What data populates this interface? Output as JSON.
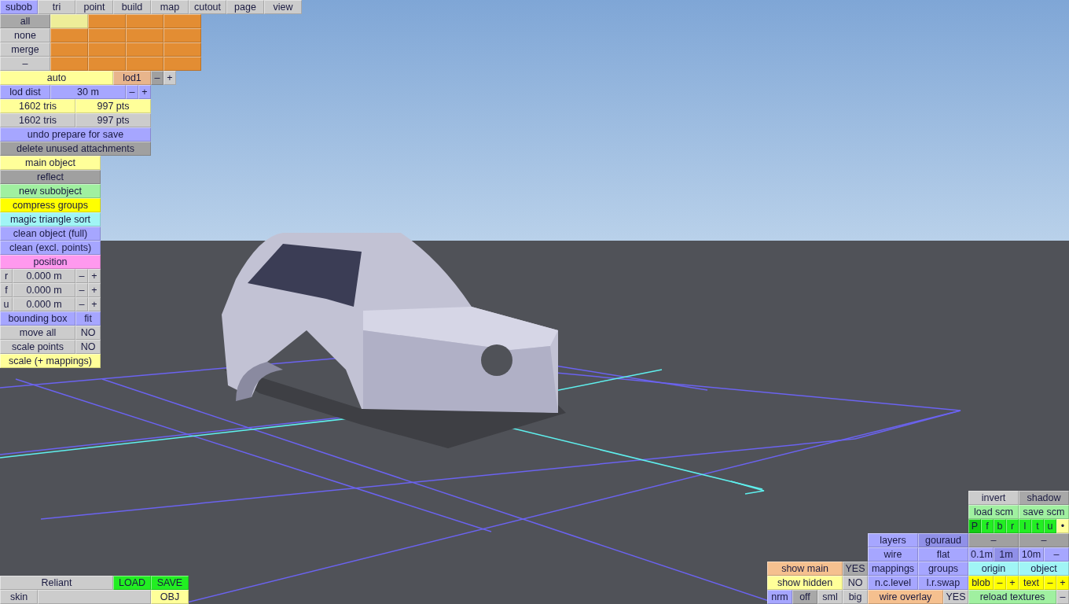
{
  "tabs": [
    {
      "label": "subob",
      "selected": true
    },
    {
      "label": "tri",
      "selected": false
    },
    {
      "label": "point",
      "selected": false
    },
    {
      "label": "build",
      "selected": false
    },
    {
      "label": "map",
      "selected": false
    },
    {
      "label": "cutout",
      "selected": false
    },
    {
      "label": "page",
      "selected": false
    },
    {
      "label": "view",
      "selected": false
    }
  ],
  "left_panel": {
    "rows": [
      {
        "buttons": [
          {
            "text": "all",
            "color": "#a8a8a8"
          },
          {
            "color": "#eeee99"
          },
          {
            "color": "#e38d33"
          },
          {
            "color": "#e38d33"
          },
          {
            "color": "#e38d33"
          }
        ]
      },
      {
        "buttons": [
          {
            "text": "none",
            "color": "#cccccc"
          },
          {
            "color": "#e38d33"
          },
          {
            "color": "#e38d33"
          },
          {
            "color": "#e38d33"
          },
          {
            "color": "#e38d33"
          }
        ]
      },
      {
        "buttons": [
          {
            "text": "merge",
            "color": "#cccccc"
          },
          {
            "color": "#e38d33"
          },
          {
            "color": "#e38d33"
          },
          {
            "color": "#e38d33"
          },
          {
            "color": "#e38d33"
          }
        ]
      },
      {
        "buttons": [
          {
            "text": "–",
            "color": "#cccccc"
          },
          {
            "color": "#e38d33"
          },
          {
            "color": "#e38d33"
          },
          {
            "color": "#e38d33"
          },
          {
            "color": "#e38d33"
          }
        ]
      },
      {
        "buttons": [
          {
            "text": "auto",
            "color": "#ffff99"
          },
          {
            "text": "lod1",
            "color": "#e8b58c"
          },
          {
            "text": "–",
            "color": "#a0a0a0"
          },
          {
            "text": "+",
            "color": "#cccccc"
          }
        ]
      },
      {
        "buttons": [
          {
            "text": "lod dist",
            "color": "#a6a6ff"
          },
          {
            "text": "30 m",
            "color": "#a6a6ff"
          },
          {
            "text": "–",
            "color": "#a6a6ff"
          },
          {
            "text": "+",
            "color": "#a6a6ff"
          }
        ]
      },
      {
        "buttons": [
          {
            "text": "1602 tris",
            "color": "#ffff99"
          },
          {
            "text": "997 pts",
            "color": "#ffff99"
          }
        ]
      },
      {
        "buttons": [
          {
            "text": "1602 tris",
            "color": "#cccccc"
          },
          {
            "text": "997 pts",
            "color": "#cccccc"
          }
        ]
      },
      {
        "buttons": [
          {
            "text": "undo prepare for save",
            "color": "#a6a6ff"
          }
        ]
      },
      {
        "buttons": [
          {
            "text": "delete unused attachments",
            "color": "#a0a0a0"
          }
        ]
      },
      {
        "buttons": [
          {
            "text": "main object",
            "color": "#ffff99"
          }
        ]
      },
      {
        "buttons": [
          {
            "text": "reflect",
            "color": "#a0a0a0"
          }
        ]
      },
      {
        "buttons": [
          {
            "text": "new subobject",
            "color": "#a0f0a0"
          }
        ]
      },
      {
        "buttons": [
          {
            "text": "compress groups",
            "color": "#ffff00"
          }
        ]
      },
      {
        "buttons": [
          {
            "text": "magic triangle sort",
            "color": "#a0f5f5"
          }
        ]
      },
      {
        "buttons": [
          {
            "text": "clean object (full)",
            "color": "#a6a6ff"
          }
        ]
      },
      {
        "buttons": [
          {
            "text": "clean (excl. points)",
            "color": "#a6a6ff"
          }
        ]
      },
      {
        "buttons": [
          {
            "text": "position",
            "color": "#ff99ee"
          }
        ]
      },
      {
        "buttons": [
          {
            "text": "r",
            "color": "#cccccc"
          },
          {
            "text": "0.000 m",
            "color": "#cccccc"
          },
          {
            "text": "–",
            "color": "#cccccc"
          },
          {
            "text": "+",
            "color": "#cccccc"
          }
        ]
      },
      {
        "buttons": [
          {
            "text": "f",
            "color": "#cccccc"
          },
          {
            "text": "0.000 m",
            "color": "#cccccc"
          },
          {
            "text": "–",
            "color": "#cccccc"
          },
          {
            "text": "+",
            "color": "#cccccc"
          }
        ]
      },
      {
        "buttons": [
          {
            "text": "u",
            "color": "#cccccc"
          },
          {
            "text": "0.000 m",
            "color": "#cccccc"
          },
          {
            "text": "–",
            "color": "#cccccc"
          },
          {
            "text": "+",
            "color": "#cccccc"
          }
        ]
      },
      {
        "buttons": [
          {
            "text": "bounding box",
            "color": "#a6a6ff"
          },
          {
            "text": "fit",
            "color": "#a6a6ff"
          }
        ]
      },
      {
        "buttons": [
          {
            "text": "move all",
            "color": "#cccccc"
          },
          {
            "text": "NO",
            "color": "#cccccc"
          }
        ]
      },
      {
        "buttons": [
          {
            "text": "scale points",
            "color": "#cccccc"
          },
          {
            "text": "NO",
            "color": "#cccccc"
          }
        ]
      },
      {
        "buttons": [
          {
            "text": "scale (+ mappings)",
            "color": "#ffff99"
          }
        ]
      }
    ]
  },
  "file_panel": {
    "rows": [
      {
        "buttons": [
          {
            "text": "Reliant",
            "color": "#cccccc"
          },
          {
            "text": "LOAD",
            "color": "#22ee22"
          },
          {
            "text": "SAVE",
            "color": "#22ee22"
          }
        ]
      },
      {
        "buttons": [
          {
            "text": "skin",
            "color": "#cccccc"
          },
          {
            "color": "#cccccc"
          },
          {
            "text": "OBJ",
            "color": "#ffff99"
          }
        ]
      }
    ]
  },
  "display_panel": {
    "rows": [
      {
        "buttons": [
          {
            "text": "show main",
            "color": "#f5c08f"
          },
          {
            "text": "YES",
            "color": "#a8a8a8"
          }
        ]
      },
      {
        "buttons": [
          {
            "text": "show hidden",
            "color": "#ffff99"
          },
          {
            "text": "NO",
            "color": "#cccccc"
          }
        ]
      },
      {
        "buttons": [
          {
            "text": "nrm",
            "color": "#a6a6ff"
          },
          {
            "text": "off",
            "color": "#a8a8a8"
          },
          {
            "text": "sml",
            "color": "#cccccc"
          },
          {
            "text": "big",
            "color": "#cccccc"
          }
        ]
      }
    ]
  },
  "render_panel": {
    "rows": [
      {
        "buttons": [
          {
            "text": "layers",
            "color": "#a6a6ff"
          },
          {
            "text": "gouraud",
            "color": "#9090e8"
          }
        ]
      },
      {
        "buttons": [
          {
            "text": "wire",
            "color": "#a6a6ff"
          },
          {
            "text": "flat",
            "color": "#a6a6ff"
          }
        ]
      },
      {
        "buttons": [
          {
            "text": "mappings",
            "color": "#a6a6ff"
          },
          {
            "text": "groups",
            "color": "#a6a6ff"
          }
        ]
      },
      {
        "buttons": [
          {
            "text": "n.c.level",
            "color": "#a6a6ff"
          },
          {
            "text": "l.r.swap",
            "color": "#a6a6ff"
          }
        ]
      },
      {
        "buttons": [
          {
            "text": "wire overlay",
            "color": "#f5c08f"
          },
          {
            "text": "YES",
            "color": "#cccccc"
          }
        ]
      }
    ]
  },
  "view_strip": {
    "buttons": [
      {
        "text": "P",
        "color": "#11cc11"
      },
      {
        "text": "f",
        "color": "#22ee22"
      },
      {
        "text": "b",
        "color": "#22ee22"
      },
      {
        "text": "r",
        "color": "#22ee22"
      },
      {
        "text": "l",
        "color": "#22ee22"
      },
      {
        "text": "t",
        "color": "#22ee22"
      },
      {
        "text": "u",
        "color": "#22ee22"
      },
      {
        "text": "•",
        "color": "#ffff99"
      }
    ]
  },
  "tools_panel": {
    "rows": [
      {
        "buttons": [
          {
            "text": "invert",
            "color": "#cccccc"
          },
          {
            "text": "shadow",
            "color": "#a8a8a8"
          }
        ]
      },
      {
        "buttons": [
          {
            "text": "load scm",
            "color": "#a0f0a0"
          },
          {
            "text": "save scm",
            "color": "#a0f0a0"
          }
        ]
      },
      {
        "buttons": [
          {
            "text": "–",
            "color": "#a0a0a0"
          },
          {
            "text": "–",
            "color": "#a0a0a0"
          }
        ]
      },
      {
        "buttons": [
          {
            "text": "0.1m",
            "color": "#a6a6ff"
          },
          {
            "text": "1m",
            "color": "#9090e8"
          },
          {
            "text": "10m",
            "color": "#a6a6ff"
          },
          {
            "text": "–",
            "color": "#a6a6ff"
          }
        ]
      },
      {
        "buttons": [
          {
            "text": "origin",
            "color": "#a0f5f5"
          },
          {
            "text": "object",
            "color": "#a0f5f5"
          }
        ]
      },
      {
        "buttons": [
          {
            "text": "blob",
            "color": "#ffff00"
          },
          {
            "text": "–",
            "color": "#ffff00"
          },
          {
            "text": "+",
            "color": "#ffff00"
          },
          {
            "text": "text",
            "color": "#ffff00"
          },
          {
            "text": "–",
            "color": "#ffff00"
          },
          {
            "text": "+",
            "color": "#ffff00"
          }
        ]
      },
      {
        "buttons": [
          {
            "text": "reload textures",
            "color": "#a0f0a0"
          },
          {
            "text": "–",
            "color": "#cccccc"
          }
        ]
      }
    ]
  }
}
